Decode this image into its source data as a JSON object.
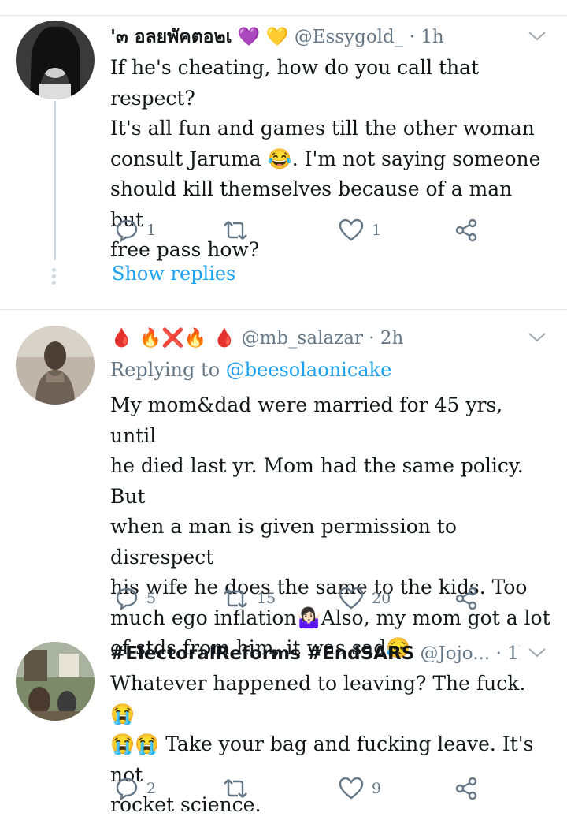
{
  "tweets": [
    {
      "name": "ิ'๓ อลยพัคตอ๒เ",
      "name_emoji": "💜 💛",
      "handle": "@Essygold_",
      "dot": "·",
      "time": "1h",
      "lines": [
        "If he's cheating, how do you call that respect?",
        "It's all fun and games till the other woman",
        "consult Jaruma 😂. I'm not saying someone",
        "should kill themselves because of a man but",
        "free pass how?"
      ],
      "reply_count": "1",
      "retweet_count": "",
      "like_count": "1",
      "show_replies": "Show replies"
    },
    {
      "name": "🩸 🔥❌🔥 🩸",
      "handle": "@mb_salazar",
      "dot": "·",
      "time": "2h",
      "replying_prefix": "Replying to ",
      "replying_to": "@beesolaonicake",
      "lines": [
        "My mom&dad were married for 45 yrs, until",
        "he died last yr. Mom had the same policy. But",
        "when a man is given permission to disrespect",
        "his wife he does the same to the kids. Too",
        "much ego inflation🤷🏻‍♀️Also, my mom got a lot",
        "of stds from him, it was sad😥"
      ],
      "reply_count": "5",
      "retweet_count": "15",
      "like_count": "20"
    },
    {
      "name": "#ElectoralReforms #EndSARS",
      "handle": "@Jojo...",
      "dot": "·",
      "time": "1h",
      "lines": [
        "Whatever happened to leaving? The fuck. 😭",
        "😭😭 Take your bag and fucking leave. It's not",
        "rocket science."
      ],
      "reply_count": "2",
      "retweet_count": "",
      "like_count": "9"
    }
  ],
  "colors": {
    "link": "#1da1f2",
    "muted": "#657786",
    "divider": "#e1e8ed"
  }
}
